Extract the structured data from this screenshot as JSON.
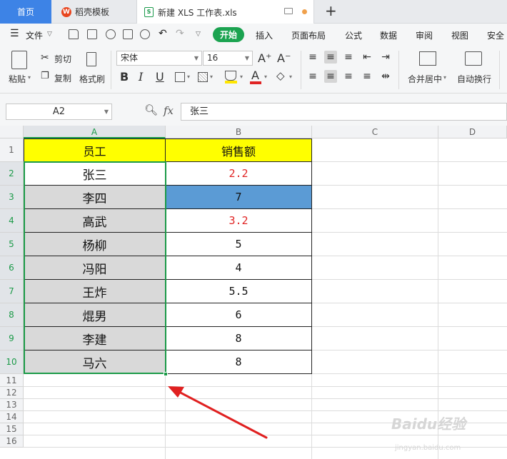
{
  "tabs": {
    "home": "首页",
    "template": "稻壳模板",
    "file": "新建 XLS 工作表.xls"
  },
  "menu": {
    "file": "文件",
    "start": "开始",
    "insert": "插入",
    "layout": "页面布局",
    "formula": "公式",
    "data": "数据",
    "review": "审阅",
    "view": "视图",
    "security": "安全"
  },
  "ribbon": {
    "paste": "粘贴",
    "cut": "剪切",
    "copy": "复制",
    "format_painter": "格式刷",
    "font_name": "宋体",
    "font_size": "16",
    "merge_center": "合并居中",
    "wrap_text": "自动换行"
  },
  "formula_bar": {
    "name_box": "A2",
    "fx": "fx",
    "value": "张三"
  },
  "columns": [
    "A",
    "B",
    "C",
    "D"
  ],
  "rows": [
    "1",
    "2",
    "3",
    "4",
    "5",
    "6",
    "7",
    "8",
    "9",
    "10",
    "11",
    "12",
    "13",
    "14",
    "15",
    "16"
  ],
  "table": {
    "header": {
      "employee": "员工",
      "sales": "销售额"
    },
    "names": [
      "张三",
      "李四",
      "高武",
      "杨柳",
      "冯阳",
      "王炸",
      "焜男",
      "李建",
      "马六"
    ],
    "sales": [
      "2.2",
      "7",
      "3.2",
      "5",
      "4",
      "5.5",
      "6",
      "8",
      "8"
    ],
    "red_rows": [
      0,
      2
    ],
    "blue_rows": [
      1
    ]
  },
  "colors": {
    "header_fill": "#ffff00",
    "selection": "#1b9a48",
    "gray_fill": "#d9d9d9",
    "blue_fill": "#5b9bd5",
    "red_text": "#e02424",
    "arrow": "#e02020"
  },
  "watermark": {
    "text": "Baidu经验",
    "sub": "jingyan.baidu.com"
  }
}
